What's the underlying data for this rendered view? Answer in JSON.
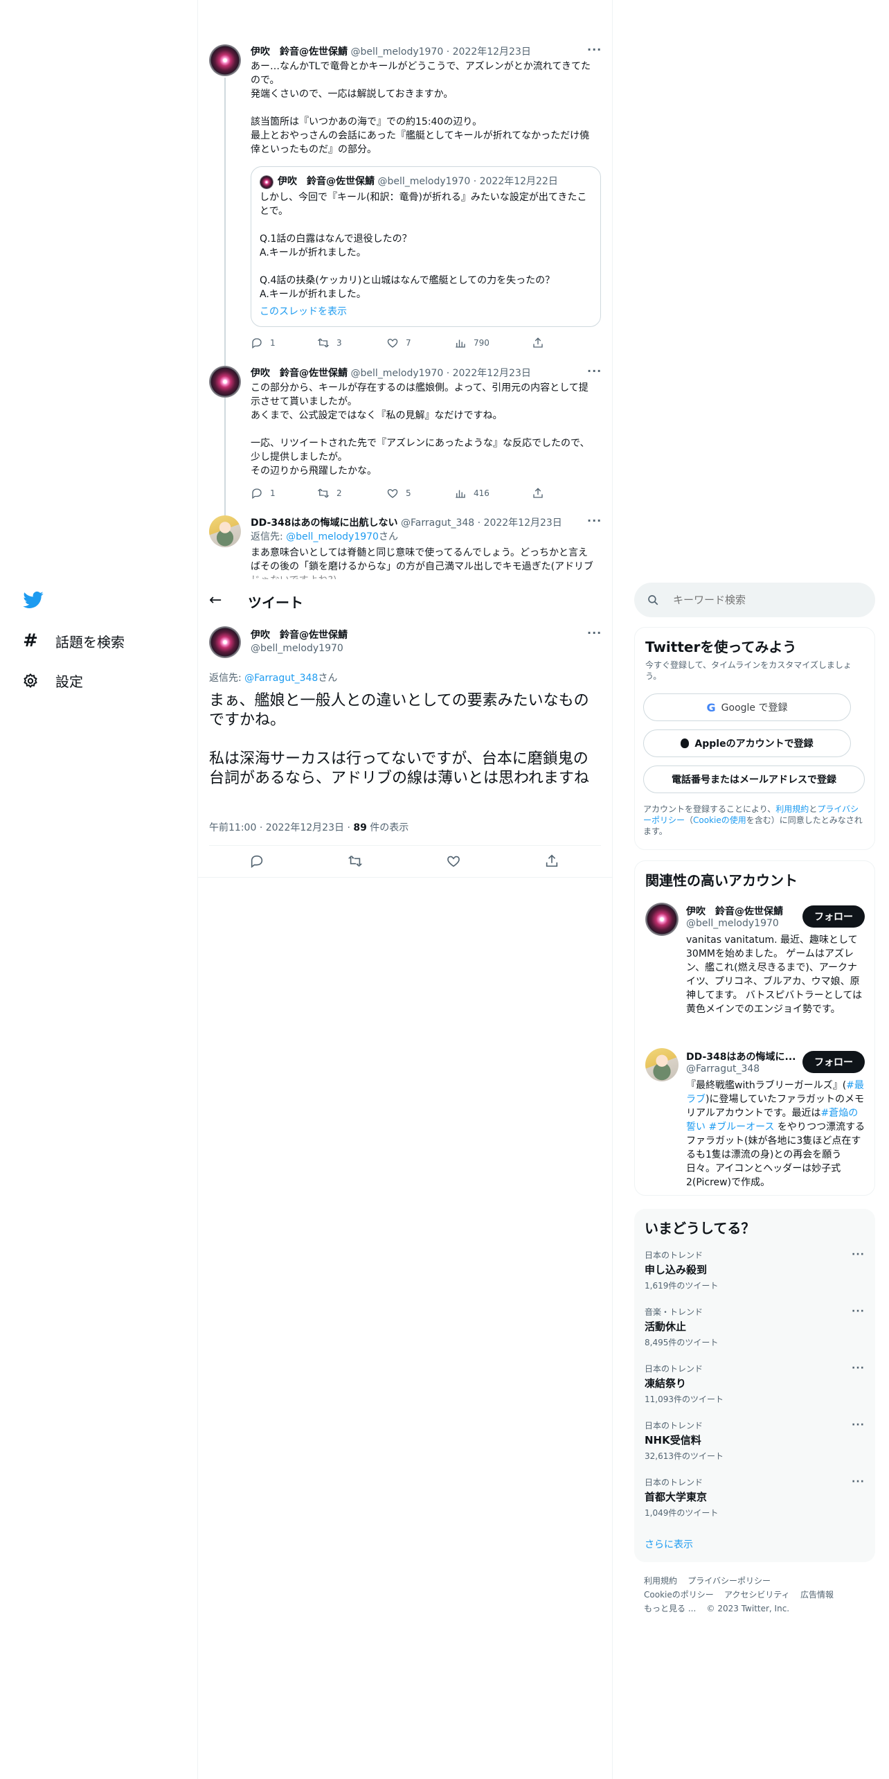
{
  "thread": [
    {
      "name": "伊吹　鈴音@佐世保鯖",
      "handle": "@bell_melody1970",
      "date": "2022年12月23日",
      "text": "あー…なんかTLで竜骨とかキールがどうこうで、アズレンがとか流れてきてたので。\n発端くさいので、一応は解説しておきますか。\n\n該当箇所は『いつかあの海で』での約15:40の辺り。\n最上とおやっさんの会話にあった『艦艇としてキールが折れてなかっただけ僥倖といったものだ』の部分。",
      "quote": {
        "name": "伊吹　鈴音@佐世保鯖",
        "handle": "@bell_melody1970",
        "date": "2022年12月22日",
        "text": "しかし、今回で『キール(和訳：竜骨)が折れる』みたいな設定が出てきたことで。\n\nQ.1話の白露はなんで退役したの？\nA.キールが折れました。\n\nQ.4話の扶桑(ケッカリ)と山城はなんで艦艇としての力を失ったの？\nA.キールが折れました。",
        "show_thread": "このスレッドを表示"
      },
      "replies": "1",
      "retweets": "3",
      "likes": "7",
      "views": "790"
    },
    {
      "name": "伊吹　鈴音@佐世保鯖",
      "handle": "@bell_melody1970",
      "date": "2022年12月23日",
      "text": "この部分から、キールが存在するのは艦娘側。よって、引用元の内容として提示させて貰いましたが。\nあくまで、公式設定ではなく『私の見解』なだけですね。\n\n一応、リツイートされた先で『アズレンにあったような』な反応でしたので、少し提供しましたが。\nその辺りから飛躍したかな。",
      "replies": "1",
      "retweets": "2",
      "likes": "5",
      "views": "416"
    },
    {
      "name": "DD-348はあの悔域に出航しない",
      "handle": "@Farragut_348",
      "date": "2022年12月23日",
      "reply_to_label": "返信先: ",
      "reply_to_handle": "@bell_melody1970",
      "reply_to_suffix": "さん",
      "text": "まあ意味合いとしては脊髄と同じ意味で使ってるんでしょう。どっちかと言えばその後の「鎖を磨けるからな」の方が自己満マル出しでキモ過ぎた(アドリブじゃないですよね?)"
    }
  ],
  "nav": {
    "explore": "話題を検索",
    "settings": "設定"
  },
  "header": {
    "title": "ツイート"
  },
  "main_tweet": {
    "name": "伊吹　鈴音@佐世保鯖",
    "handle": "@bell_melody1970",
    "reply_to_label": "返信先: ",
    "reply_to_handle": "@Farragut_348",
    "reply_to_suffix": "さん",
    "text": "まぁ、艦娘と一般人との違いとしての要素みたいなものですかね。\n\n私は深海サーカスは行ってないですが、台本に磨鎖鬼の台詞があるなら、アドリブの線は薄いとは思われますね",
    "time": "午前11:00",
    "date": "2022年12月23日",
    "views_count": "89",
    "views_label": " 件の表示"
  },
  "search": {
    "placeholder": "キーワード検索"
  },
  "signup": {
    "title": "Twitterを使ってみよう",
    "subtitle": "今すぐ登録して、タイムラインをカスタマイズしましょう。",
    "google": "Google で登録",
    "apple": "Appleのアカウントで登録",
    "phone": "電話番号またはメールアドレスで登録",
    "terms_1": "アカウントを登録することにより、",
    "terms_link_1": "利用規約",
    "terms_2": "と",
    "terms_link_2": "プライバシーポリシー",
    "terms_3": "（",
    "terms_link_3": "Cookieの使用",
    "terms_4": "を含む）に同意したとみなされます。"
  },
  "related": {
    "title": "関連性の高いアカウント",
    "follow": "フォロー",
    "accounts": [
      {
        "name": "伊吹　鈴音@佐世保鯖",
        "handle": "@bell_melody1970",
        "bio": "vanitas vanitatum. 最近、趣味として30MMを始めました。 ゲームはアズレン、艦これ(燃え尽きるまで)、アークナイツ、プリコネ、ブルアカ、ウマ娘、原神してます。 バトスピバトラーとしては黄色メインでのエンジョイ勢です。"
      },
      {
        "name": "DD-348はあの悔域に...",
        "handle": "@Farragut_348",
        "bio_1": "『最終戦艦withラブリーガールズ』(",
        "bio_link_1": "#最ラブ",
        "bio_2": ")に登場していたファラガットのメモリアルアカウントです。最近は",
        "bio_link_2": "#蒼焔の誓い",
        "bio_3": " ",
        "bio_link_3": "#ブルーオース",
        "bio_4": " をやりつつ漂流するファラガット(妹が各地に3隻ほど点在するも1隻は漂流の身)との再会を願う日々。アイコンとヘッダーは妙子式2(Picrew)で作成。"
      }
    ]
  },
  "trends": {
    "title": "いまどうしてる？",
    "items": [
      {
        "category": "日本のトレンド",
        "name": "申し込み殺到",
        "count": "1,619件のツイート"
      },
      {
        "category": "音楽・トレンド",
        "name": "活動休止",
        "count": "8,495件のツイート"
      },
      {
        "category": "日本のトレンド",
        "name": "凍結祭り",
        "count": "11,093件のツイート"
      },
      {
        "category": "日本のトレンド",
        "name": "NHK受信料",
        "count": "32,613件のツイート"
      },
      {
        "category": "日本のトレンド",
        "name": "首都大学東京",
        "count": "1,049件のツイート"
      }
    ],
    "show_more": "さらに表示"
  },
  "footer": {
    "terms": "利用規約",
    "privacy": "プライバシーポリシー",
    "cookie": "Cookieのポリシー",
    "accessibility": "アクセシビリティ",
    "ads": "広告情報",
    "more": "もっと見る ...",
    "copyright": "© 2023 Twitter, Inc."
  },
  "colors": {
    "accent": "#1d9bf0",
    "text": "#0f1419",
    "muted": "#536471",
    "panel": "#f7f9f9",
    "border": "#eff3f4"
  }
}
